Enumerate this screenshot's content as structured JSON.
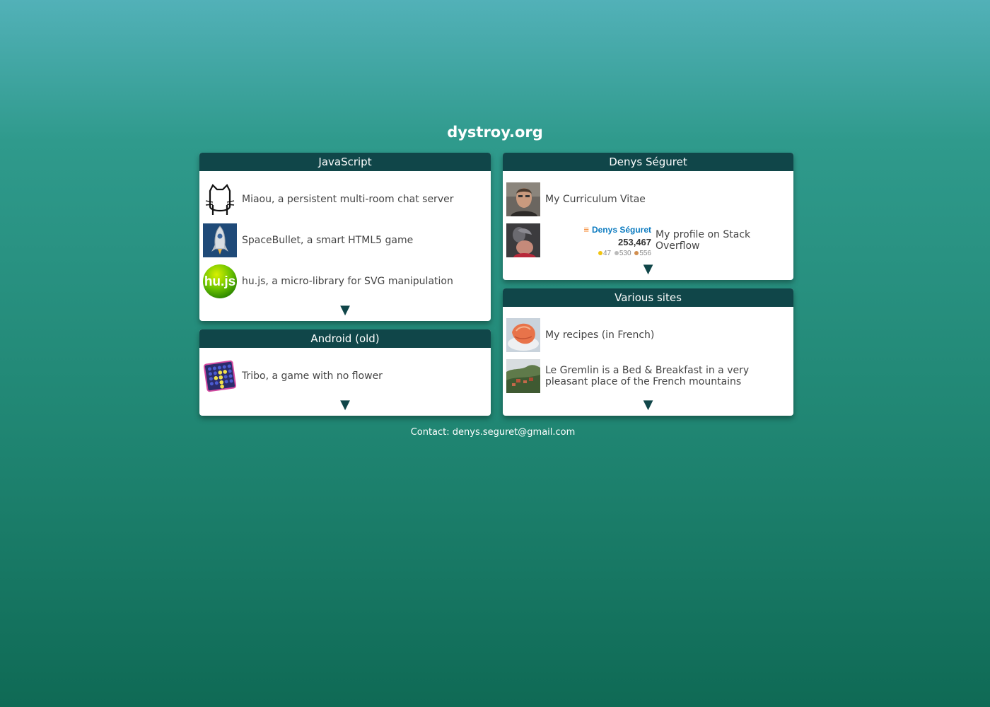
{
  "site": {
    "title": "dystroy.org"
  },
  "panels": {
    "javascript": {
      "title": "JavaScript",
      "items": [
        {
          "label": "Miaou, a persistent multi-room chat server",
          "icon": "cat-icon"
        },
        {
          "label": "SpaceBullet, a smart HTML5 game",
          "icon": "rocket-icon"
        },
        {
          "label": "hu.js, a micro-library for SVG manipulation",
          "icon": "hujs-logo-icon",
          "icon_text": "hu.js"
        }
      ],
      "more": "▼"
    },
    "android": {
      "title": "Android (old)",
      "items": [
        {
          "label": "Tribo, a game with no flower",
          "icon": "grid-game-icon"
        }
      ],
      "more": "▼"
    },
    "denys": {
      "title": "Denys Séguret",
      "items": [
        {
          "label": "My Curriculum Vitae",
          "icon": "portrait-photo"
        },
        {
          "label": "My profile on Stack Overflow",
          "icon": "avatar-photo"
        }
      ],
      "so_flair": {
        "name": "Denys Séguret",
        "reputation": "253,467",
        "gold": "47",
        "silver": "530",
        "bronze": "556"
      },
      "more": "▼"
    },
    "various": {
      "title": "Various sites",
      "items": [
        {
          "label": "My recipes (in French)",
          "icon": "recipe-photo"
        },
        {
          "label": "Le Gremlin is a Bed & Breakfast in a very pleasant place of the French mountains",
          "icon": "village-photo"
        }
      ],
      "more": "▼"
    }
  },
  "footer": {
    "contact": "Contact: denys.seguret@gmail.com"
  },
  "colors": {
    "header": "#104649",
    "accent": "#104649"
  }
}
